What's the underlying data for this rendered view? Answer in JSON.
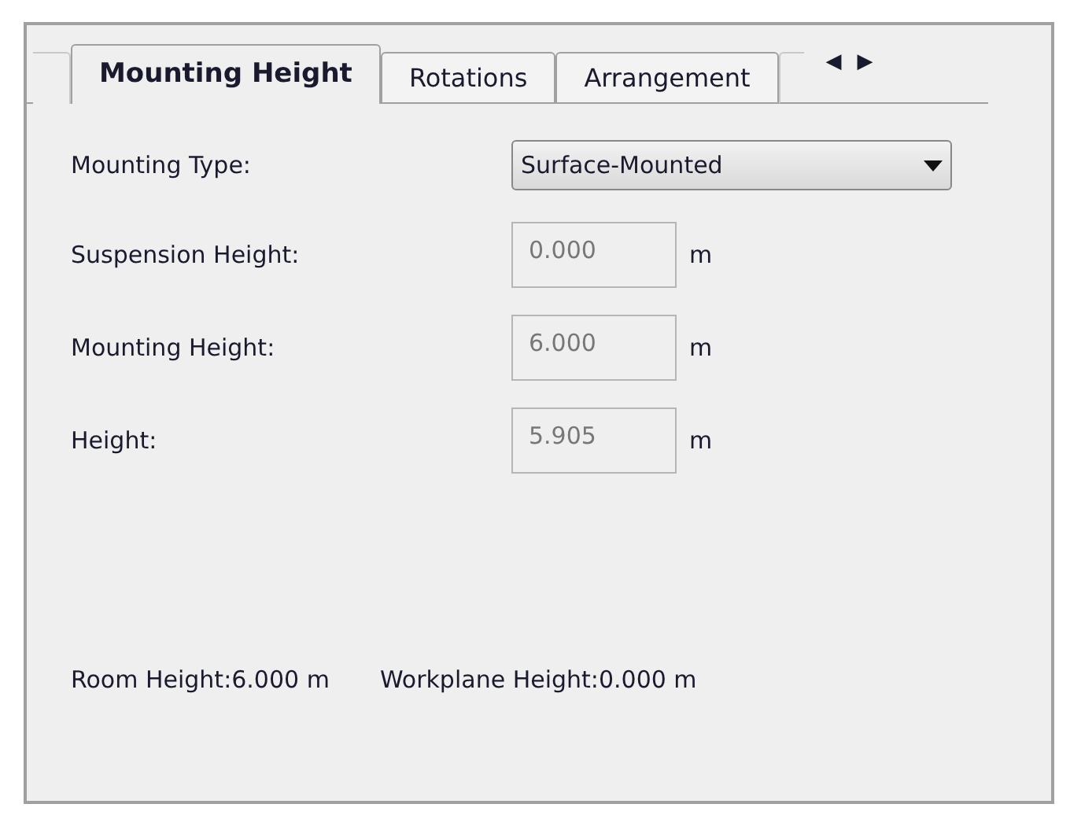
{
  "tabs": [
    {
      "label": "Mounting Height",
      "selected": true
    },
    {
      "label": "Rotations",
      "selected": false
    },
    {
      "label": "Arrangement",
      "selected": false
    }
  ],
  "tab_scroll": {
    "left": "◀",
    "right": "▶"
  },
  "mounting_type": {
    "label": "Mounting Type:",
    "value": "Surface-Mounted"
  },
  "fields": [
    {
      "label": "Suspension Height:",
      "value": "0.000",
      "unit": "m",
      "disabled": true
    },
    {
      "label": "Mounting Height:",
      "value": "6.000",
      "unit": "m",
      "disabled": true
    },
    {
      "label": "Height:",
      "value": "5.905",
      "unit": "m",
      "disabled": true
    }
  ],
  "footer": {
    "room_height": "Room Height:6.000 m",
    "workplane_height": "Workplane Height:0.000 m"
  }
}
